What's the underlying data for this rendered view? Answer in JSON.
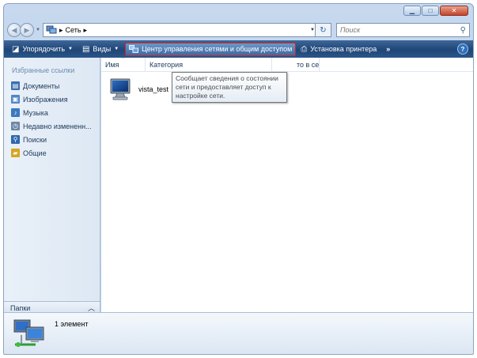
{
  "address": {
    "path": [
      "Сеть"
    ],
    "search_placeholder": "Поиск"
  },
  "toolbar": {
    "organize": "Упорядочить",
    "views": "Виды",
    "network_center": "Центр управления сетями и общим доступом",
    "add_printer": "Установка принтера",
    "more": "»",
    "help": "?"
  },
  "sidebar": {
    "favorites_heading": "Избранные ссылки",
    "items": [
      {
        "label": "Документы",
        "color": "#3b6fb0"
      },
      {
        "label": "Изображения",
        "color": "#4f86c6"
      },
      {
        "label": "Музыка",
        "color": "#3a78c2"
      },
      {
        "label": "Недавно измененн...",
        "color": "#6d87a8"
      },
      {
        "label": "Поиски",
        "color": "#2f67ad"
      },
      {
        "label": "Общие",
        "color": "#d9a520"
      }
    ],
    "folders_label": "Папки"
  },
  "columns": {
    "name": "Имя",
    "category": "Категория",
    "workgroup_tail": "то в сети"
  },
  "items": [
    {
      "name": "vista_test",
      "icon": "computer-icon"
    }
  ],
  "tooltip": "Сообщает сведения о состоянии сети и предоставляет доступ к настройке сети.",
  "details": {
    "count": "1 элемент",
    "icon": "network-icon"
  },
  "colors": {
    "toolbar_bg": "#1f4677",
    "highlight_border": "#d42525",
    "link_text": "#1e395b"
  }
}
